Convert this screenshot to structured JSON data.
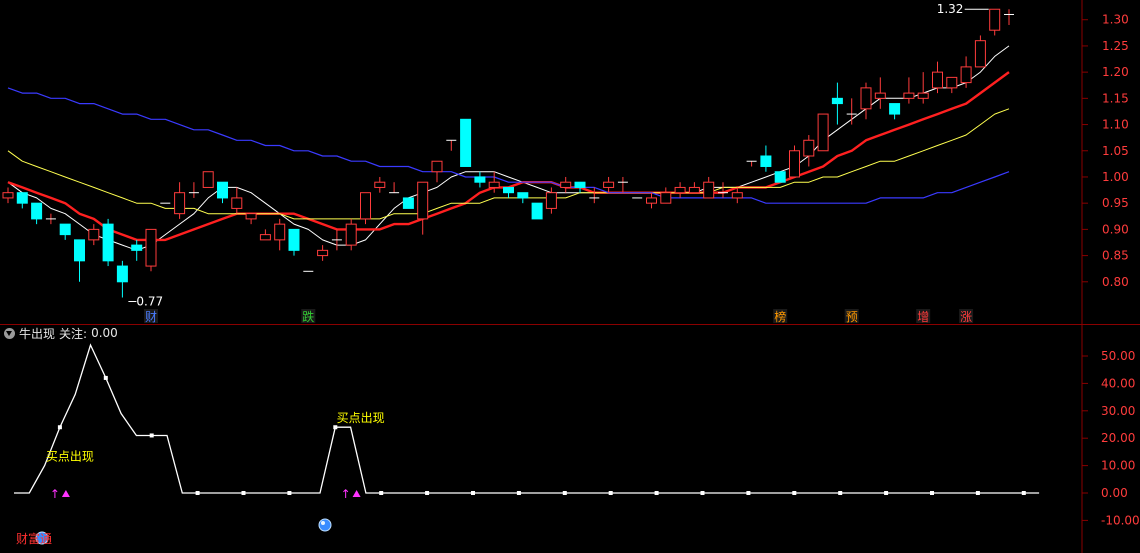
{
  "indicator_header": {
    "name": "牛出现",
    "focus_label": "关注:",
    "focus_value": "0.00"
  },
  "colors": {
    "up": "#ff3c3c",
    "down": "#00ffff",
    "ma5": "#ffffff",
    "ma10": "#ff2020",
    "ma20": "#ffff50",
    "ma60": "#3a3aff",
    "grid": "#8a0000",
    "axis_text": "#ff3c3c"
  },
  "chart_data": [
    {
      "type": "candlestick",
      "ylim": [
        0.75,
        1.33
      ],
      "y_ticks": [
        0.8,
        0.85,
        0.9,
        0.95,
        1.0,
        1.05,
        1.1,
        1.15,
        1.2,
        1.25,
        1.3
      ],
      "y_tick_labels": [
        "0.80",
        "0.85",
        "0.90",
        "0.95",
        "1.00",
        "1.05",
        "1.10",
        "1.15",
        "1.20",
        "1.25",
        "1.30"
      ],
      "candles": [
        [
          0.96,
          0.97,
          0.98,
          0.95
        ],
        [
          0.97,
          0.95,
          0.97,
          0.94
        ],
        [
          0.95,
          0.92,
          0.95,
          0.91
        ],
        [
          0.92,
          0.92,
          0.93,
          0.91
        ],
        [
          0.91,
          0.89,
          0.91,
          0.88
        ],
        [
          0.88,
          0.84,
          0.88,
          0.8
        ],
        [
          0.88,
          0.9,
          0.91,
          0.87
        ],
        [
          0.91,
          0.84,
          0.92,
          0.83
        ],
        [
          0.83,
          0.8,
          0.84,
          0.77
        ],
        [
          0.87,
          0.86,
          0.88,
          0.84
        ],
        [
          0.83,
          0.9,
          0.9,
          0.82
        ],
        [
          0.95,
          0.95,
          0.95,
          0.95
        ],
        [
          0.93,
          0.97,
          0.99,
          0.92
        ],
        [
          0.97,
          0.97,
          0.99,
          0.96
        ],
        [
          0.98,
          1.01,
          1.01,
          0.98
        ],
        [
          0.99,
          0.96,
          0.99,
          0.95
        ],
        [
          0.94,
          0.96,
          0.98,
          0.93
        ],
        [
          0.92,
          0.93,
          0.93,
          0.91
        ],
        [
          0.88,
          0.89,
          0.9,
          0.88
        ],
        [
          0.88,
          0.91,
          0.92,
          0.86
        ],
        [
          0.9,
          0.86,
          0.9,
          0.85
        ],
        [
          0.82,
          0.82,
          0.82,
          0.82
        ],
        [
          0.85,
          0.86,
          0.87,
          0.84
        ],
        [
          0.88,
          0.88,
          0.9,
          0.86
        ],
        [
          0.87,
          0.91,
          0.92,
          0.86
        ],
        [
          0.92,
          0.97,
          0.97,
          0.91
        ],
        [
          0.98,
          0.99,
          1.0,
          0.97
        ],
        [
          0.97,
          0.97,
          0.99,
          0.97
        ],
        [
          0.96,
          0.94,
          0.96,
          0.94
        ],
        [
          0.92,
          0.99,
          0.99,
          0.89
        ],
        [
          1.01,
          1.03,
          1.03,
          0.99
        ],
        [
          1.07,
          1.07,
          1.07,
          1.05
        ],
        [
          1.11,
          1.02,
          1.11,
          1.02
        ],
        [
          1.0,
          0.99,
          1.01,
          0.98
        ],
        [
          0.98,
          0.99,
          1.01,
          0.97
        ],
        [
          0.98,
          0.97,
          0.98,
          0.96
        ],
        [
          0.97,
          0.96,
          0.97,
          0.95
        ],
        [
          0.95,
          0.92,
          0.95,
          0.92
        ],
        [
          0.94,
          0.97,
          0.98,
          0.93
        ],
        [
          0.98,
          0.99,
          1.0,
          0.97
        ],
        [
          0.99,
          0.98,
          0.99,
          0.97
        ],
        [
          0.96,
          0.96,
          0.98,
          0.95
        ],
        [
          0.98,
          0.99,
          1.0,
          0.97
        ],
        [
          0.99,
          0.99,
          1.0,
          0.97
        ],
        [
          0.96,
          0.96,
          0.96,
          0.96
        ],
        [
          0.95,
          0.96,
          0.97,
          0.94
        ],
        [
          0.95,
          0.97,
          0.98,
          0.95
        ],
        [
          0.97,
          0.98,
          0.99,
          0.96
        ],
        [
          0.97,
          0.98,
          0.99,
          0.97
        ],
        [
          0.96,
          0.99,
          1.0,
          0.96
        ],
        [
          0.97,
          0.97,
          0.99,
          0.96
        ],
        [
          0.96,
          0.97,
          0.98,
          0.95
        ],
        [
          1.03,
          1.03,
          1.03,
          1.02
        ],
        [
          1.04,
          1.02,
          1.06,
          1.01
        ],
        [
          1.01,
          0.99,
          1.01,
          0.99
        ],
        [
          1.0,
          1.05,
          1.06,
          1.0
        ],
        [
          1.04,
          1.07,
          1.08,
          1.02
        ],
        [
          1.05,
          1.12,
          1.12,
          1.05
        ],
        [
          1.15,
          1.14,
          1.18,
          1.1
        ],
        [
          1.12,
          1.12,
          1.15,
          1.1
        ],
        [
          1.13,
          1.17,
          1.18,
          1.11
        ],
        [
          1.15,
          1.16,
          1.19,
          1.13
        ],
        [
          1.14,
          1.12,
          1.14,
          1.11
        ],
        [
          1.15,
          1.16,
          1.19,
          1.14
        ],
        [
          1.15,
          1.16,
          1.2,
          1.14
        ],
        [
          1.17,
          1.2,
          1.22,
          1.16
        ],
        [
          1.17,
          1.19,
          1.19,
          1.16
        ],
        [
          1.18,
          1.21,
          1.23,
          1.17
        ],
        [
          1.21,
          1.26,
          1.27,
          1.21
        ],
        [
          1.28,
          1.32,
          1.32,
          1.27
        ],
        [
          1.31,
          1.31,
          1.32,
          1.29
        ]
      ],
      "ma_series": [
        {
          "key": "ma5",
          "values": [
            0.99,
            0.97,
            0.96,
            0.94,
            0.93,
            0.91,
            0.89,
            0.88,
            0.87,
            0.86,
            0.87,
            0.89,
            0.91,
            0.93,
            0.96,
            0.98,
            0.98,
            0.97,
            0.95,
            0.93,
            0.91,
            0.9,
            0.88,
            0.87,
            0.87,
            0.88,
            0.91,
            0.94,
            0.96,
            0.97,
            0.98,
            1.0,
            1.01,
            1.01,
            1.01,
            1.0,
            0.99,
            0.98,
            0.97,
            0.97,
            0.97,
            0.97,
            0.97,
            0.97,
            0.97,
            0.97,
            0.97,
            0.97,
            0.97,
            0.98,
            0.98,
            0.98,
            0.99,
            1.0,
            1.01,
            1.02,
            1.04,
            1.07,
            1.09,
            1.11,
            1.13,
            1.15,
            1.15,
            1.15,
            1.16,
            1.17,
            1.17,
            1.18,
            1.2,
            1.23,
            1.25
          ]
        },
        {
          "key": "ma10",
          "values": [
            0.99,
            0.98,
            0.97,
            0.96,
            0.95,
            0.93,
            0.92,
            0.9,
            0.89,
            0.88,
            0.88,
            0.88,
            0.89,
            0.9,
            0.91,
            0.92,
            0.93,
            0.93,
            0.93,
            0.93,
            0.93,
            0.92,
            0.91,
            0.9,
            0.9,
            0.9,
            0.9,
            0.91,
            0.91,
            0.92,
            0.93,
            0.94,
            0.95,
            0.97,
            0.98,
            0.98,
            0.99,
            0.99,
            0.99,
            0.98,
            0.98,
            0.97,
            0.97,
            0.97,
            0.97,
            0.97,
            0.97,
            0.97,
            0.97,
            0.97,
            0.97,
            0.98,
            0.98,
            0.98,
            0.99,
            1.0,
            1.01,
            1.02,
            1.04,
            1.05,
            1.07,
            1.08,
            1.09,
            1.1,
            1.11,
            1.12,
            1.13,
            1.14,
            1.16,
            1.18,
            1.2
          ]
        },
        {
          "key": "ma20",
          "values": [
            1.05,
            1.03,
            1.02,
            1.01,
            1.0,
            0.99,
            0.98,
            0.97,
            0.96,
            0.95,
            0.95,
            0.94,
            0.94,
            0.94,
            0.93,
            0.93,
            0.93,
            0.93,
            0.93,
            0.93,
            0.92,
            0.92,
            0.92,
            0.92,
            0.92,
            0.92,
            0.92,
            0.93,
            0.93,
            0.93,
            0.94,
            0.95,
            0.95,
            0.95,
            0.96,
            0.96,
            0.96,
            0.96,
            0.96,
            0.96,
            0.97,
            0.97,
            0.97,
            0.97,
            0.97,
            0.97,
            0.97,
            0.97,
            0.97,
            0.97,
            0.98,
            0.98,
            0.98,
            0.98,
            0.98,
            0.99,
            0.99,
            1.0,
            1.0,
            1.01,
            1.02,
            1.03,
            1.03,
            1.04,
            1.05,
            1.06,
            1.07,
            1.08,
            1.1,
            1.12,
            1.13
          ]
        },
        {
          "key": "ma60",
          "values": [
            1.17,
            1.16,
            1.16,
            1.15,
            1.15,
            1.14,
            1.14,
            1.13,
            1.12,
            1.12,
            1.11,
            1.11,
            1.1,
            1.09,
            1.09,
            1.08,
            1.07,
            1.07,
            1.06,
            1.06,
            1.05,
            1.05,
            1.04,
            1.04,
            1.03,
            1.03,
            1.02,
            1.02,
            1.02,
            1.01,
            1.01,
            1.01,
            1.0,
            1.0,
            1.0,
            0.99,
            0.99,
            0.99,
            0.99,
            0.98,
            0.98,
            0.98,
            0.97,
            0.97,
            0.97,
            0.97,
            0.96,
            0.96,
            0.96,
            0.96,
            0.96,
            0.96,
            0.96,
            0.95,
            0.95,
            0.95,
            0.95,
            0.95,
            0.95,
            0.95,
            0.95,
            0.96,
            0.96,
            0.96,
            0.96,
            0.97,
            0.97,
            0.98,
            0.99,
            1.0,
            1.01
          ]
        }
      ],
      "annotations": [
        {
          "text": "1.32",
          "at": 69,
          "price": 1.32,
          "side": "left"
        },
        {
          "text": "0.77",
          "at": 8,
          "price": 0.77,
          "side": "right"
        }
      ],
      "event_labels": [
        {
          "text": "财",
          "at": 10,
          "color": "#4a7cff"
        },
        {
          "text": "跌",
          "at": 21,
          "color": "#33cc33"
        },
        {
          "text": "榜",
          "at": 54,
          "color": "#ff9900"
        },
        {
          "text": "预",
          "at": 59,
          "color": "#ff9900"
        },
        {
          "text": "增",
          "at": 64,
          "color": "#ff3c3c"
        },
        {
          "text": "涨",
          "at": 67,
          "color": "#ff3c3c"
        }
      ]
    },
    {
      "type": "line",
      "ylim": [
        -15,
        58
      ],
      "y_ticks": [
        -10,
        0,
        10,
        20,
        30,
        40,
        50
      ],
      "y_tick_labels": [
        "-10.00",
        "0.00",
        "10.00",
        "20.00",
        "30.00",
        "40.00",
        "50.00"
      ],
      "x": [
        0,
        1,
        2,
        3,
        4,
        5,
        6,
        7,
        8,
        9,
        10,
        11,
        12,
        13,
        14,
        15,
        16,
        17,
        18,
        19,
        20,
        21,
        22,
        23,
        24,
        25,
        26,
        27,
        28,
        29,
        30,
        31,
        32,
        33,
        34,
        35,
        36,
        37,
        38,
        39,
        40,
        41,
        42,
        43,
        44,
        45,
        46,
        47,
        48,
        49,
        50,
        51,
        52,
        53,
        54,
        55,
        56,
        57,
        58,
        59,
        60,
        61,
        62,
        63,
        64,
        65,
        66,
        67
      ],
      "values": [
        0,
        0,
        10,
        24,
        36,
        54,
        42,
        29,
        21,
        21,
        21,
        0,
        0,
        0,
        0,
        0,
        0,
        0,
        0,
        0,
        0,
        24,
        24,
        0,
        0,
        0,
        0,
        0,
        0,
        0,
        0,
        0,
        0,
        0,
        0,
        0,
        0,
        0,
        0,
        0,
        0,
        0,
        0,
        0,
        0,
        0,
        0,
        0,
        0,
        0,
        0,
        0,
        0,
        0,
        0,
        0,
        0,
        0,
        0,
        0,
        0,
        0,
        0,
        0,
        0,
        0,
        0,
        0
      ],
      "marker_every": 3,
      "buy_signals": [
        {
          "text": "买点出现",
          "at": 3,
          "value": 10
        },
        {
          "text": "买点出现",
          "at": 22,
          "value": 24
        }
      ],
      "up_markers": [
        3,
        22
      ],
      "bottom_label": "财富通"
    }
  ]
}
